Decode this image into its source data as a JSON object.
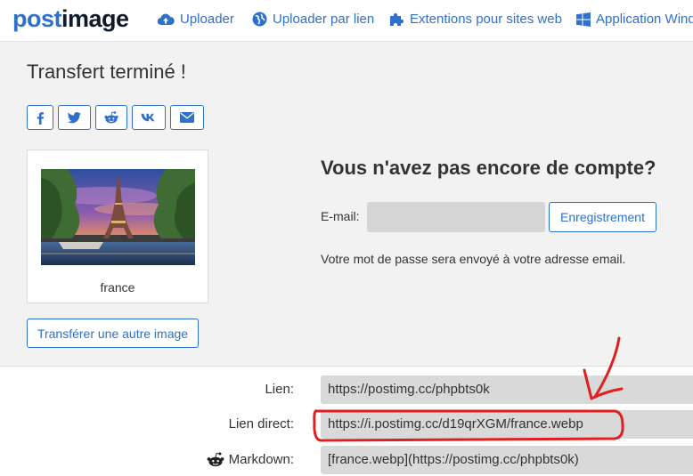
{
  "brand": {
    "part1": "post",
    "part2": "image"
  },
  "nav": {
    "items": [
      {
        "label": "Uploader"
      },
      {
        "label": "Uploader par lien"
      },
      {
        "label": "Extentions pour sites web"
      },
      {
        "label": "Application Windo"
      }
    ]
  },
  "page": {
    "title": "Transfert terminé !"
  },
  "share": {
    "items": [
      "facebook-icon",
      "twitter-icon",
      "reddit-icon",
      "vk-icon",
      "mail-icon"
    ]
  },
  "thumbnail": {
    "caption": "france"
  },
  "other_upload": {
    "label": "Transférer une autre image"
  },
  "account": {
    "title": "Vous n'avez pas encore de compte?",
    "email_label": "E-mail:",
    "email_value": "",
    "register_label": "Enregistrement",
    "password_note": "Votre mot de passe sera envoyé à votre adresse email."
  },
  "links": {
    "link": {
      "label": "Lien:",
      "value": "https://postimg.cc/phpbts0k"
    },
    "direct": {
      "label": "Lien direct:",
      "value": "https://i.postimg.cc/d19qrXGM/france.webp"
    },
    "markdown": {
      "label": "Markdown:",
      "value": "[france.webp](https://postimg.cc/phpbts0k)"
    }
  },
  "colors": {
    "accent": "#2f71c8",
    "annotation": "#e02020",
    "panel": "#f2f2f2",
    "field": "#d9d9d9"
  }
}
